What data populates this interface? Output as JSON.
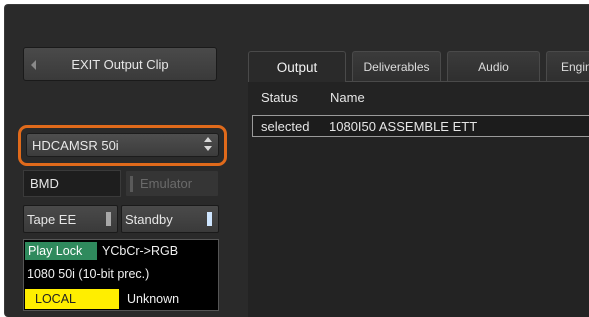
{
  "left": {
    "exit_button": "EXIT Output Clip",
    "format": {
      "value": "HDCAMSR 50i"
    },
    "device": "BMD",
    "emulator": "Emulator",
    "tape_ee": "Tape EE",
    "standby": "Standby",
    "status": {
      "play_lock": "Play Lock",
      "color_conversion": "YCbCr->RGB",
      "video_format": "1080 50i (10-bit prec.)",
      "remote_mode": "LOCAL",
      "tape_state": "Unknown"
    }
  },
  "tabs": [
    {
      "label": "Output",
      "active": true
    },
    {
      "label": "Deliverables",
      "active": false
    },
    {
      "label": "Audio",
      "active": false
    },
    {
      "label": "Engin",
      "active": false
    }
  ],
  "table": {
    "columns": [
      "Status",
      "Name"
    ],
    "rows": [
      {
        "status": "selected",
        "name": "1080I50 ASSEMBLE ETT"
      }
    ]
  },
  "colors": {
    "highlight_ring": "#e06a1b",
    "play_lock_bg": "#2f8a5d",
    "local_bg": "#ffee00"
  }
}
